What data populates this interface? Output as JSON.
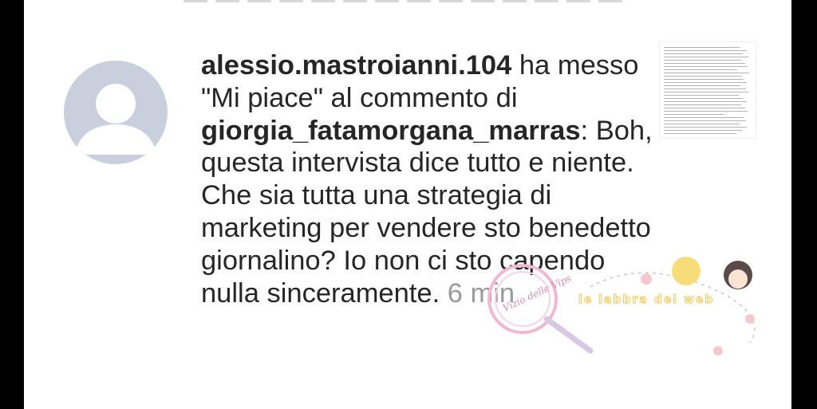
{
  "notification": {
    "actor": "alessio.mastroianni.104",
    "action_part1": " ha messo \"Mi piace\" al commento di ",
    "comment_author": "giorgia_fatamorgana_marras",
    "colon": ":",
    "comment_text": " Boh, questa intervista dice tutto e niente. Che sia tutta una strategia di marketing per vendere sto benedetto giornalino? Io non ci sto capendo nulla sinceramente.",
    "timestamp": " 6 min"
  },
  "avatar": {
    "icon": "default-user-silhouette-icon",
    "bg_color": "#c9cfdd"
  },
  "thumbnail": {
    "icon": "text-article-thumbnail"
  },
  "watermark": {
    "stamp_text": "Vizio delle Vips",
    "banner_text": "le labbra del web"
  },
  "colors": {
    "text": "#262626",
    "timestamp": "#9a9a9a",
    "background": "#ffffff",
    "frame": "#000000"
  }
}
